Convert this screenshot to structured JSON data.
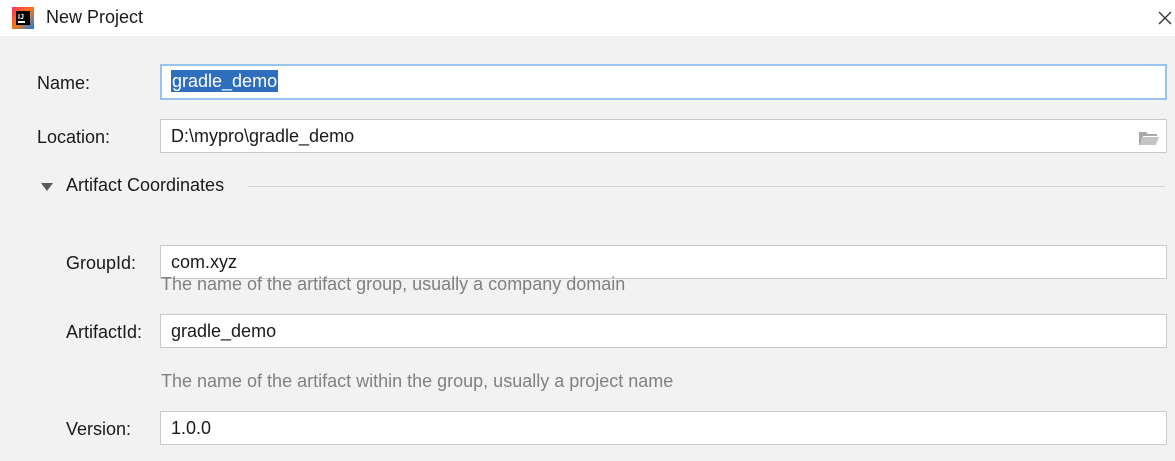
{
  "window": {
    "title": "New Project",
    "app_icon": "intellij-icon",
    "close_icon": "close-icon"
  },
  "form": {
    "name": {
      "label": "Name:",
      "value": "gradle_demo"
    },
    "location": {
      "label": "Location:",
      "value": "D:\\mypro\\gradle_demo",
      "browse_icon": "folder-icon"
    },
    "artifact_section": {
      "title": "Artifact Coordinates",
      "expanded": true,
      "toggle_icon": "triangle-down-icon",
      "group_id": {
        "label": "GroupId:",
        "value": "com.xyz",
        "hint": "The name of the artifact group, usually a company domain"
      },
      "artifact_id": {
        "label": "ArtifactId:",
        "value": "gradle_demo",
        "hint": "The name of the artifact within the group, usually a project name"
      },
      "version": {
        "label": "Version:",
        "value": "1.0.0"
      }
    }
  },
  "colors": {
    "selection": "#2e6fbd",
    "focus_border": "#97c3ee",
    "background": "#f2f2f2",
    "hint_text": "#808080"
  }
}
